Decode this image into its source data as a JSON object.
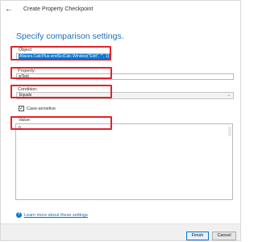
{
  "window": {
    "title": "Create Property Checkpoint"
  },
  "heading": "Specify comparison settings.",
  "object": {
    "label": "Object:",
    "value": "Aliases.CalcPlus.wndSciCalc.Window(\"Edit\", \"\", 1)"
  },
  "property": {
    "label": "Property:",
    "value": "wText"
  },
  "condition": {
    "label": "Condition:",
    "selected": "Equals"
  },
  "case_sensitive": {
    "label": "Case-sensitive",
    "checked": true
  },
  "value": {
    "label": "Value:",
    "text": "0."
  },
  "help_link": "Learn more about these settings",
  "buttons": {
    "finish": "Finish",
    "cancel": "Cancel"
  },
  "colors": {
    "highlight": "#e0242a",
    "accent": "#0078d7",
    "heading": "#1c6fb9"
  },
  "icons": {
    "back": "arrow-left-icon",
    "info": "info-icon",
    "dropdown": "chevron-down-icon",
    "check": "checkmark-icon"
  }
}
